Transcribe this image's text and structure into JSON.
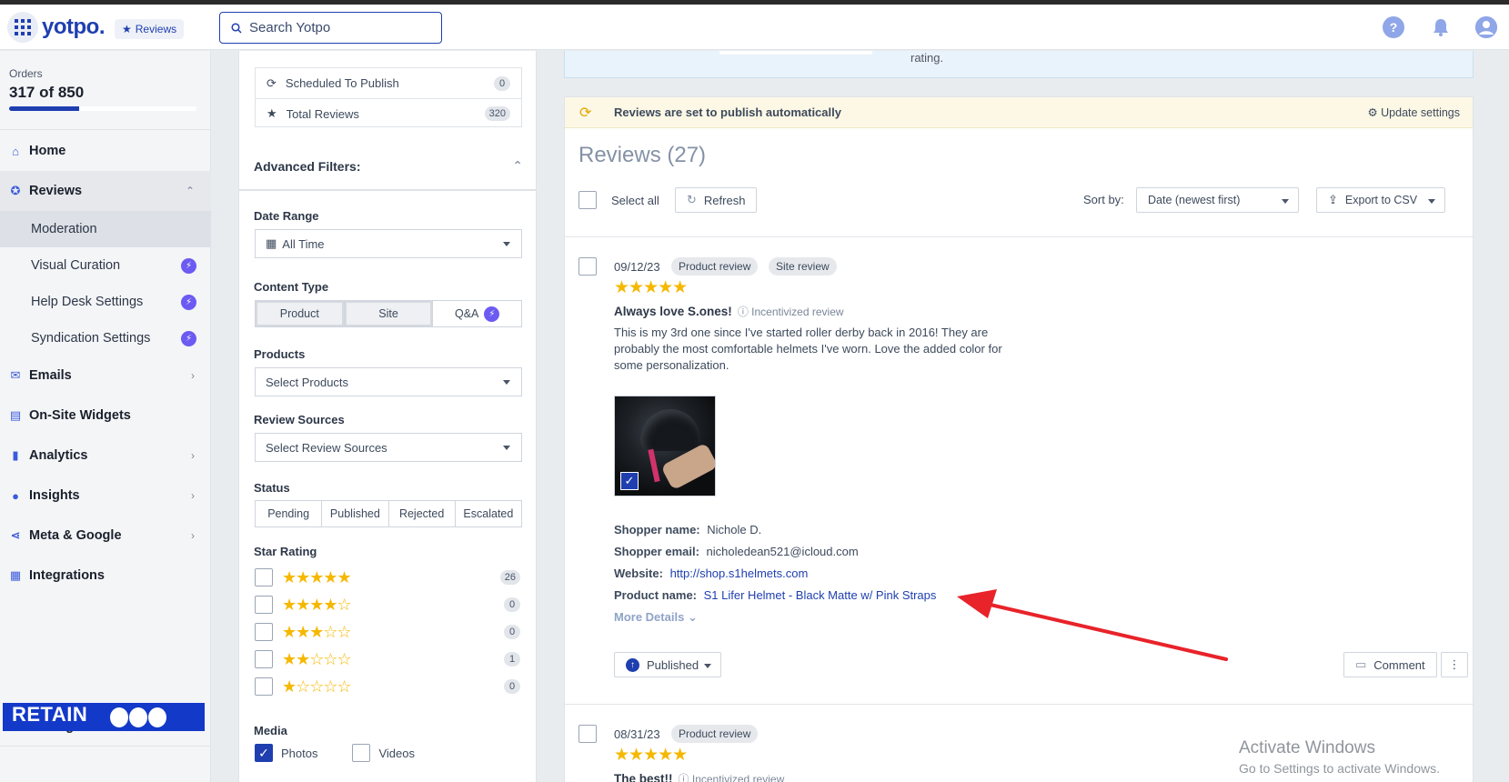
{
  "topbar": {
    "logo": "yotpo.",
    "app_chip": "Reviews",
    "search_placeholder": "Search Yotpo"
  },
  "sidebar": {
    "orders_label": "Orders",
    "orders_value": "317 of 850",
    "orders_progress": 0.373,
    "items": [
      {
        "label": "Home",
        "icon": "home-icon"
      },
      {
        "label": "Reviews",
        "icon": "star-badge-icon"
      },
      {
        "label": "Emails",
        "icon": "mail-icon"
      },
      {
        "label": "On-Site Widgets",
        "icon": "widget-icon"
      },
      {
        "label": "Analytics",
        "icon": "bar-chart-icon"
      },
      {
        "label": "Insights",
        "icon": "lightbulb-icon"
      },
      {
        "label": "Meta & Google",
        "icon": "share-icon"
      },
      {
        "label": "Integrations",
        "icon": "grid-icon"
      },
      {
        "label": "Settings",
        "icon": "gear-icon"
      }
    ],
    "subitems": [
      {
        "label": "Moderation"
      },
      {
        "label": "Visual Curation"
      },
      {
        "label": "Help Desk Settings"
      },
      {
        "label": "Syndication Settings"
      }
    ],
    "promo": "RETAIN"
  },
  "filters": {
    "scheduled_label": "Scheduled To Publish",
    "scheduled_count": "0",
    "total_label": "Total Reviews",
    "total_count": "320",
    "advanced_label": "Advanced Filters:",
    "date_range_label": "Date Range",
    "date_range_value": "All Time",
    "content_type_label": "Content Type",
    "content_types": [
      "Product",
      "Site",
      "Q&A"
    ],
    "products_label": "Products",
    "products_placeholder": "Select Products",
    "sources_label": "Review Sources",
    "sources_placeholder": "Select Review Sources",
    "status_label": "Status",
    "statuses": [
      "Pending",
      "Published",
      "Rejected",
      "Escalated"
    ],
    "star_rating_label": "Star Rating",
    "star_counts": [
      "26",
      "0",
      "0",
      "1",
      "0"
    ],
    "media_label": "Media",
    "media_photos": "Photos",
    "media_videos": "Videos"
  },
  "main": {
    "top_card_text": "rating.",
    "banner_text": "Reviews are set to publish automatically",
    "banner_settings": "Update settings",
    "reviews_title": "Reviews (27)",
    "select_all": "Select all",
    "refresh": "Refresh",
    "sort_by_label": "Sort by:",
    "sort_value": "Date (newest first)",
    "export": "Export to CSV",
    "review1": {
      "date": "09/12/23",
      "tag1": "Product review",
      "tag2": "Site review",
      "rating": 5,
      "title": "Always love S.ones!",
      "incentivized": "Incentivized review",
      "body": "This is my 3rd one since I've started roller derby back in 2016! They are probably the most comfortable helmets I've worn. Love the added color for some personalization.",
      "shopper_name_label": "Shopper name:",
      "shopper_name": "Nichole D.",
      "shopper_email_label": "Shopper email:",
      "shopper_email": "nicholedean521@icloud.com",
      "website_label": "Website:",
      "website": "http://shop.s1helmets.com",
      "product_label": "Product name:",
      "product": "S1 Lifer Helmet - Black Matte w/ Pink Straps",
      "more_details": "More Details",
      "status": "Published",
      "comment": "Comment"
    },
    "review2": {
      "date": "08/31/23",
      "tag1": "Product review",
      "rating": 5,
      "title": "The best!!",
      "incentivized": "Incentivized review"
    }
  },
  "watermark": {
    "line1": "Activate Windows",
    "line2": "Go to Settings to activate Windows."
  },
  "colors": {
    "brand": "#1f3fb0",
    "star": "#f5b800",
    "bolt": "#6b5bf2",
    "arrow": "#e8232a"
  }
}
